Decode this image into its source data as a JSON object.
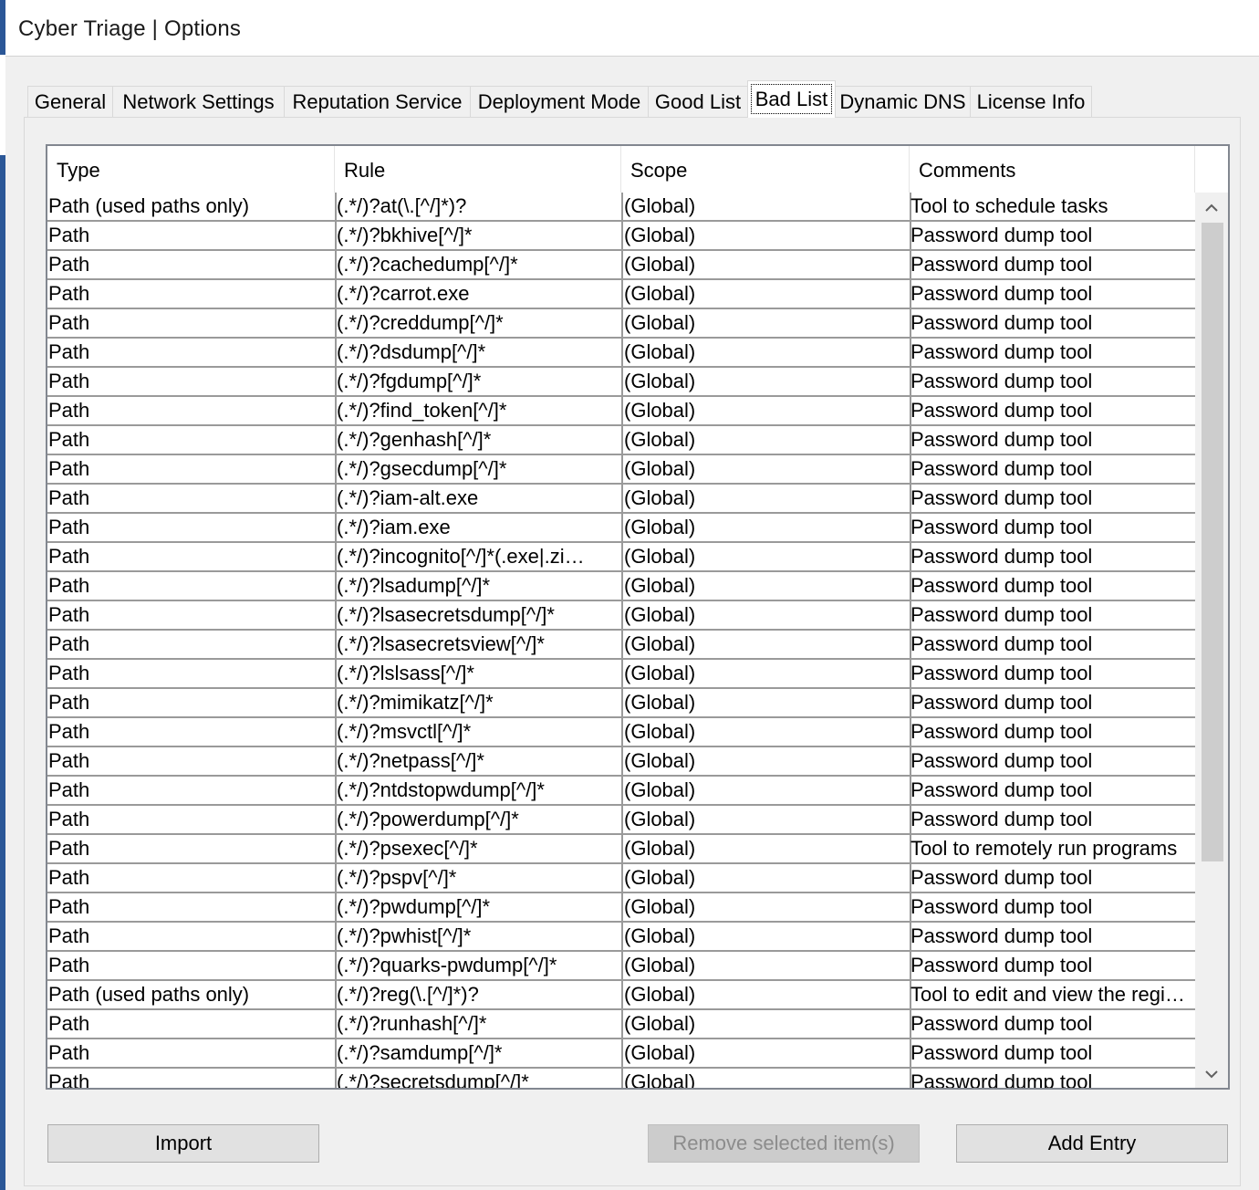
{
  "window": {
    "title": "Cyber Triage | Options"
  },
  "tabs": [
    {
      "label": "General"
    },
    {
      "label": "Network Settings"
    },
    {
      "label": "Reputation Service"
    },
    {
      "label": "Deployment Mode"
    },
    {
      "label": "Good List"
    },
    {
      "label": "Bad List",
      "active": true
    },
    {
      "label": "Dynamic DNS"
    },
    {
      "label": "License Info"
    }
  ],
  "table": {
    "columns": [
      "Type",
      "Rule",
      "Scope",
      "Comments"
    ],
    "rows": [
      [
        "Path (used paths only)",
        "(.*/)?at(\\.[^/]*)?",
        "(Global)",
        "Tool to schedule tasks"
      ],
      [
        "Path",
        "(.*/)?bkhive[^/]*",
        "(Global)",
        "Password dump tool"
      ],
      [
        "Path",
        "(.*/)?cachedump[^/]*",
        "(Global)",
        "Password dump tool"
      ],
      [
        "Path",
        "(.*/)?carrot.exe",
        "(Global)",
        "Password dump tool"
      ],
      [
        "Path",
        "(.*/)?creddump[^/]*",
        "(Global)",
        "Password dump tool"
      ],
      [
        "Path",
        "(.*/)?dsdump[^/]*",
        "(Global)",
        "Password dump tool"
      ],
      [
        "Path",
        "(.*/)?fgdump[^/]*",
        "(Global)",
        "Password dump tool"
      ],
      [
        "Path",
        "(.*/)?find_token[^/]*",
        "(Global)",
        "Password dump tool"
      ],
      [
        "Path",
        "(.*/)?genhash[^/]*",
        "(Global)",
        "Password dump tool"
      ],
      [
        "Path",
        "(.*/)?gsecdump[^/]*",
        "(Global)",
        "Password dump tool"
      ],
      [
        "Path",
        "(.*/)?iam-alt.exe",
        "(Global)",
        "Password dump tool"
      ],
      [
        "Path",
        "(.*/)?iam.exe",
        "(Global)",
        "Password dump tool"
      ],
      [
        "Path",
        "(.*/)?incognito[^/]*(.exe|.zi…",
        "(Global)",
        "Password dump tool"
      ],
      [
        "Path",
        "(.*/)?lsadump[^/]*",
        "(Global)",
        "Password dump tool"
      ],
      [
        "Path",
        "(.*/)?lsasecretsdump[^/]*",
        "(Global)",
        "Password dump tool"
      ],
      [
        "Path",
        "(.*/)?lsasecretsview[^/]*",
        "(Global)",
        "Password dump tool"
      ],
      [
        "Path",
        "(.*/)?lslsass[^/]*",
        "(Global)",
        "Password dump tool"
      ],
      [
        "Path",
        "(.*/)?mimikatz[^/]*",
        "(Global)",
        "Password dump tool"
      ],
      [
        "Path",
        "(.*/)?msvctl[^/]*",
        "(Global)",
        "Password dump tool"
      ],
      [
        "Path",
        "(.*/)?netpass[^/]*",
        "(Global)",
        "Password dump tool"
      ],
      [
        "Path",
        "(.*/)?ntdstopwdump[^/]*",
        "(Global)",
        "Password dump tool"
      ],
      [
        "Path",
        "(.*/)?powerdump[^/]*",
        "(Global)",
        "Password dump tool"
      ],
      [
        "Path",
        "(.*/)?psexec[^/]*",
        "(Global)",
        "Tool to remotely run programs"
      ],
      [
        "Path",
        "(.*/)?pspv[^/]*",
        "(Global)",
        "Password dump tool"
      ],
      [
        "Path",
        "(.*/)?pwdump[^/]*",
        "(Global)",
        "Password dump tool"
      ],
      [
        "Path",
        "(.*/)?pwhist[^/]*",
        "(Global)",
        "Password dump tool"
      ],
      [
        "Path",
        "(.*/)?quarks-pwdump[^/]*",
        "(Global)",
        "Password dump tool"
      ],
      [
        "Path (used paths only)",
        "(.*/)?reg(\\.[^/]*)?",
        "(Global)",
        "Tool to edit and view the regi…"
      ],
      [
        "Path",
        "(.*/)?runhash[^/]*",
        "(Global)",
        "Password dump tool"
      ],
      [
        "Path",
        "(.*/)?samdump[^/]*",
        "(Global)",
        "Password dump tool"
      ],
      [
        "Path",
        "(.*/)?secretsdump[^/]*",
        "(Global)",
        "Password dump tool"
      ]
    ]
  },
  "scrollbar": {
    "up_icon": "chevron-up-icon",
    "down_icon": "chevron-down-icon"
  },
  "buttons": {
    "import": "Import",
    "remove": "Remove selected item(s)",
    "add": "Add Entry"
  }
}
